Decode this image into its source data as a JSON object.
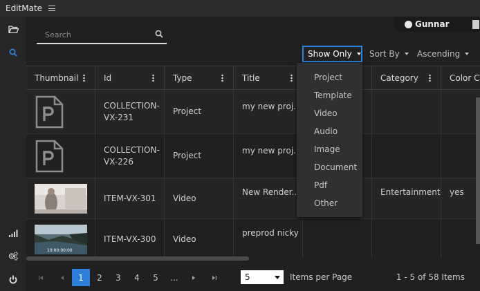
{
  "app": {
    "title": "EditMate"
  },
  "sidebar": {
    "items": [
      {
        "icon": "folder-open-icon"
      },
      {
        "icon": "search-icon",
        "active": true
      },
      {
        "icon": "signal-bars-icon"
      },
      {
        "icon": "gears-icon"
      },
      {
        "icon": "power-icon"
      }
    ]
  },
  "user": {
    "name": "Gunnar"
  },
  "search": {
    "placeholder": "Search",
    "value": ""
  },
  "filters": {
    "show_only": "Show Only",
    "sort_by": "Sort By",
    "order": "Ascending"
  },
  "show_only_menu": [
    "Project",
    "Template",
    "Video",
    "Audio",
    "Image",
    "Document",
    "Pdf",
    "Other"
  ],
  "table": {
    "columns": [
      "Thumbnail",
      "Id",
      "Type",
      "Title",
      "",
      "Category",
      "Color C"
    ],
    "rows": [
      {
        "thumb": "document-p-icon",
        "id": "COLLECTION-VX-231",
        "type": "Project",
        "title": "my new proj...",
        "category": "",
        "color": ""
      },
      {
        "thumb": "document-p-icon",
        "id": "COLLECTION-VX-226",
        "type": "Project",
        "title": "my new proj...",
        "category": "",
        "color": ""
      },
      {
        "thumb": "video-frame",
        "id": "ITEM-VX-301",
        "type": "Video",
        "title": "New Render...",
        "category": "Entertainment",
        "color": "yes"
      },
      {
        "thumb": "video-frame-landscape",
        "id": "ITEM-VX-300",
        "type": "Video",
        "title": "preprod nicky",
        "category": "",
        "color": ""
      }
    ]
  },
  "thumb_timecode": "10:00:00:00",
  "pagination": {
    "pages": [
      "1",
      "2",
      "3",
      "4",
      "5",
      "..."
    ],
    "current": "1",
    "per_page": "5",
    "per_page_label": "Items per Page",
    "range": "1 - 5 of 58 Items"
  },
  "colors": {
    "accent": "#2e7fd9",
    "background": "#202020",
    "sidebar": "#262626"
  }
}
